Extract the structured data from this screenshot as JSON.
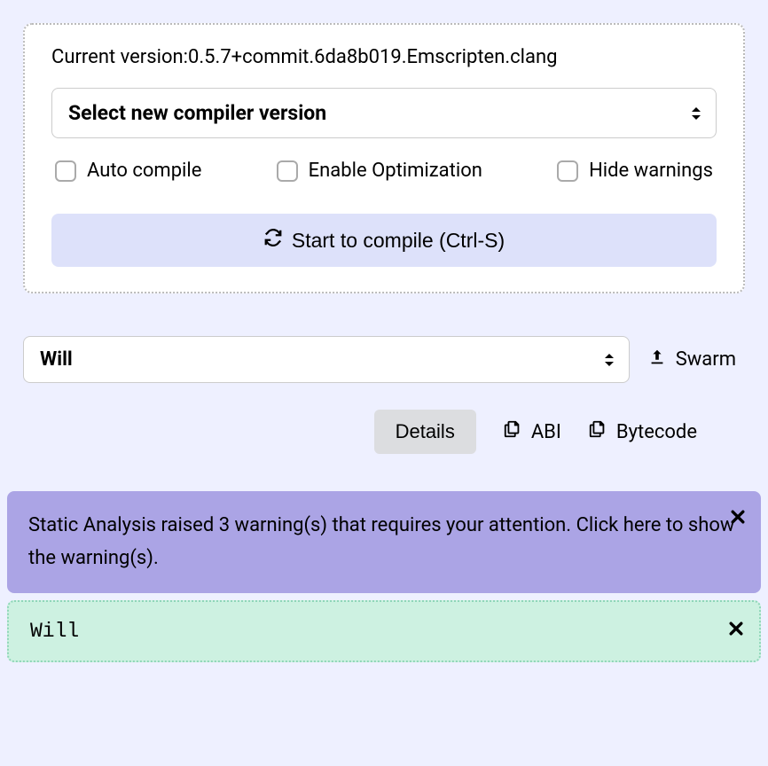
{
  "compiler": {
    "version_label": "Current version:0.5.7+commit.6da8b019.Emscripten.clang",
    "select_placeholder": "Select new compiler version",
    "checkboxes": {
      "auto_compile": "Auto compile",
      "enable_optimization": "Enable Optimization",
      "hide_warnings": "Hide warnings"
    },
    "compile_button": "Start to compile (Ctrl-S)"
  },
  "contract": {
    "selected": "Will",
    "swarm_label": "Swarm",
    "details_label": "Details",
    "abi_label": "ABI",
    "bytecode_label": "Bytecode"
  },
  "alerts": {
    "warning_text": "Static Analysis raised 3 warning(s) that requires your attention. Click here to show the warning(s).",
    "success_text": "Will"
  }
}
